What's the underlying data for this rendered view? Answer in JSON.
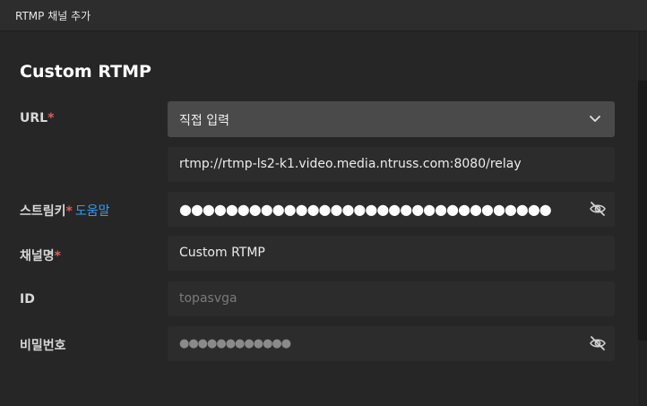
{
  "window": {
    "title": "RTMP 채널 추가"
  },
  "form": {
    "heading": "Custom RTMP",
    "url": {
      "label": "URL",
      "required_mark": "*",
      "select_value": "직접 입력",
      "input_value": "rtmp://rtmp-ls2-k1.video.media.ntruss.com:8080/relay"
    },
    "stream_key": {
      "label": "스트림키",
      "required_mark": "*",
      "help_link": "도움말",
      "masked_value": "●●●●●●●●●●●●●●●●●●●●●●●●●●●●●●●●"
    },
    "channel_name": {
      "label": "채널명",
      "required_mark": "*",
      "value": "Custom RTMP"
    },
    "id": {
      "label": "ID",
      "placeholder": "topasvga"
    },
    "password": {
      "label": "비밀번호",
      "placeholder_dots": "●●●●●●●●●●●●"
    }
  },
  "icons": {
    "select_arrow": "chevron-down-icon",
    "visibility_toggle": "eye-off-icon"
  },
  "colors": {
    "background": "#262626",
    "field": "#2c2c2c",
    "select": "#4a4a4a",
    "required": "#e05c5c",
    "link": "#3a9bf0"
  }
}
